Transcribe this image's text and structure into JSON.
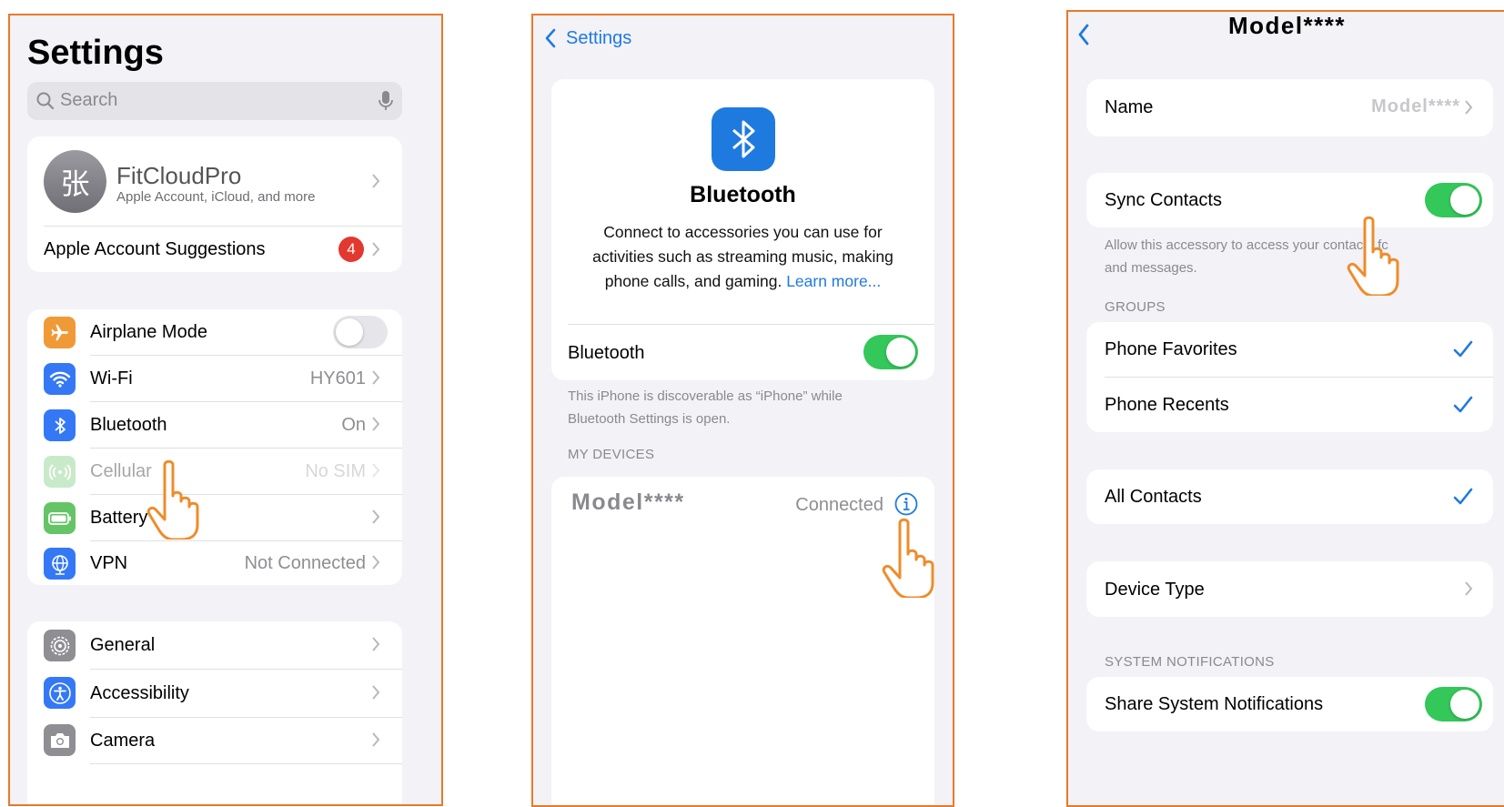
{
  "panel1": {
    "title": "Settings",
    "search": {
      "placeholder": "Search"
    },
    "profile": {
      "avatar_text": "张",
      "name": "FitCloudPro",
      "subtitle": "Apple Account, iCloud, and more"
    },
    "suggestions": {
      "label": "Apple Account Suggestions",
      "badge": "4"
    },
    "network": [
      {
        "label": "Airplane Mode",
        "icon": "airplane-icon",
        "color": "#f09a37"
      },
      {
        "label": "Wi-Fi",
        "value": "HY601",
        "icon": "wifi-icon",
        "color": "#3478f6"
      },
      {
        "label": "Bluetooth",
        "value": "On",
        "icon": "bluetooth-icon",
        "color": "#3478f6"
      },
      {
        "label": "Cellular",
        "value": "No SIM",
        "icon": "cellular-icon",
        "color": "#65c466"
      },
      {
        "label": "Battery",
        "icon": "battery-icon",
        "color": "#65c466"
      },
      {
        "label": "VPN",
        "value": "Not Connected",
        "icon": "vpn-icon",
        "color": "#3478f6"
      }
    ],
    "general": [
      {
        "label": "General",
        "icon": "gear-icon",
        "color": "#8e8e93"
      },
      {
        "label": "Accessibility",
        "icon": "accessibility-icon",
        "color": "#3478f6"
      },
      {
        "label": "Camera",
        "icon": "camera-icon",
        "color": "#8e8e93"
      }
    ]
  },
  "panel2": {
    "back_label": "Settings",
    "heading": "Bluetooth",
    "description": "Connect to accessories you can use for activities such as streaming music, making phone calls, and gaming.",
    "learn_more": "Learn more...",
    "toggle_label": "Bluetooth",
    "toggle_on": true,
    "discoverable_note": "This iPhone is discoverable as “iPhone” while Bluetooth Settings is open.",
    "my_devices_header": "MY DEVICES",
    "device": {
      "name": "Model****",
      "status": "Connected"
    }
  },
  "panel3": {
    "title": "Model****",
    "name_label": "Name",
    "name_value": "Model****",
    "sync_contacts_label": "Sync Contacts",
    "sync_contacts_on": true,
    "sync_note": "Allow this accessory to access your contacts for calls and messages.",
    "sync_note_line1": "Allow this accessory to access your contacts fc",
    "sync_note_line2": "and messages.",
    "groups_header": "GROUPS",
    "groups": [
      "Phone Favorites",
      "Phone Recents"
    ],
    "all_contacts": "All Contacts",
    "device_type": "Device Type",
    "system_notifications_header": "SYSTEM NOTIFICATIONS",
    "share_notifications_label": "Share System Notifications",
    "share_notifications_on": true
  },
  "colors": {
    "accent": "#1f7ae0",
    "toggle_on": "#34c759",
    "frame": "#e8792a",
    "badge": "#e2382f"
  }
}
